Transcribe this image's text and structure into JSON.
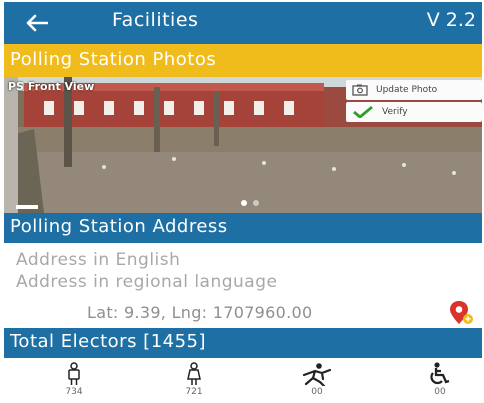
{
  "header": {
    "title": "Facilities",
    "version": "V 2.2",
    "back_icon": "arrow-left-icon"
  },
  "photos_section": {
    "title": "Polling Station Photos",
    "photo_label": "PS Front View",
    "update_button": "Update Photo",
    "verify_button": "Verify"
  },
  "address_section": {
    "title": "Polling Station Address",
    "address_english_placeholder": "Address in English",
    "address_regional_placeholder": "Address in regional language",
    "coordinates": "Lat: 9.39, Lng: 1707960.00"
  },
  "electors_section": {
    "title": "Total Electors [1455]",
    "categories": [
      {
        "icon": "male-icon",
        "count": "734"
      },
      {
        "icon": "female-icon",
        "count": "721"
      },
      {
        "icon": "third-gender-icon",
        "count": "00"
      },
      {
        "icon": "wheelchair-icon",
        "count": "00"
      }
    ]
  },
  "colors": {
    "primary": "#1e6fa3",
    "accent": "#f0bc1c",
    "verify_check": "#2e9e2e",
    "pin": "#d9342b"
  }
}
